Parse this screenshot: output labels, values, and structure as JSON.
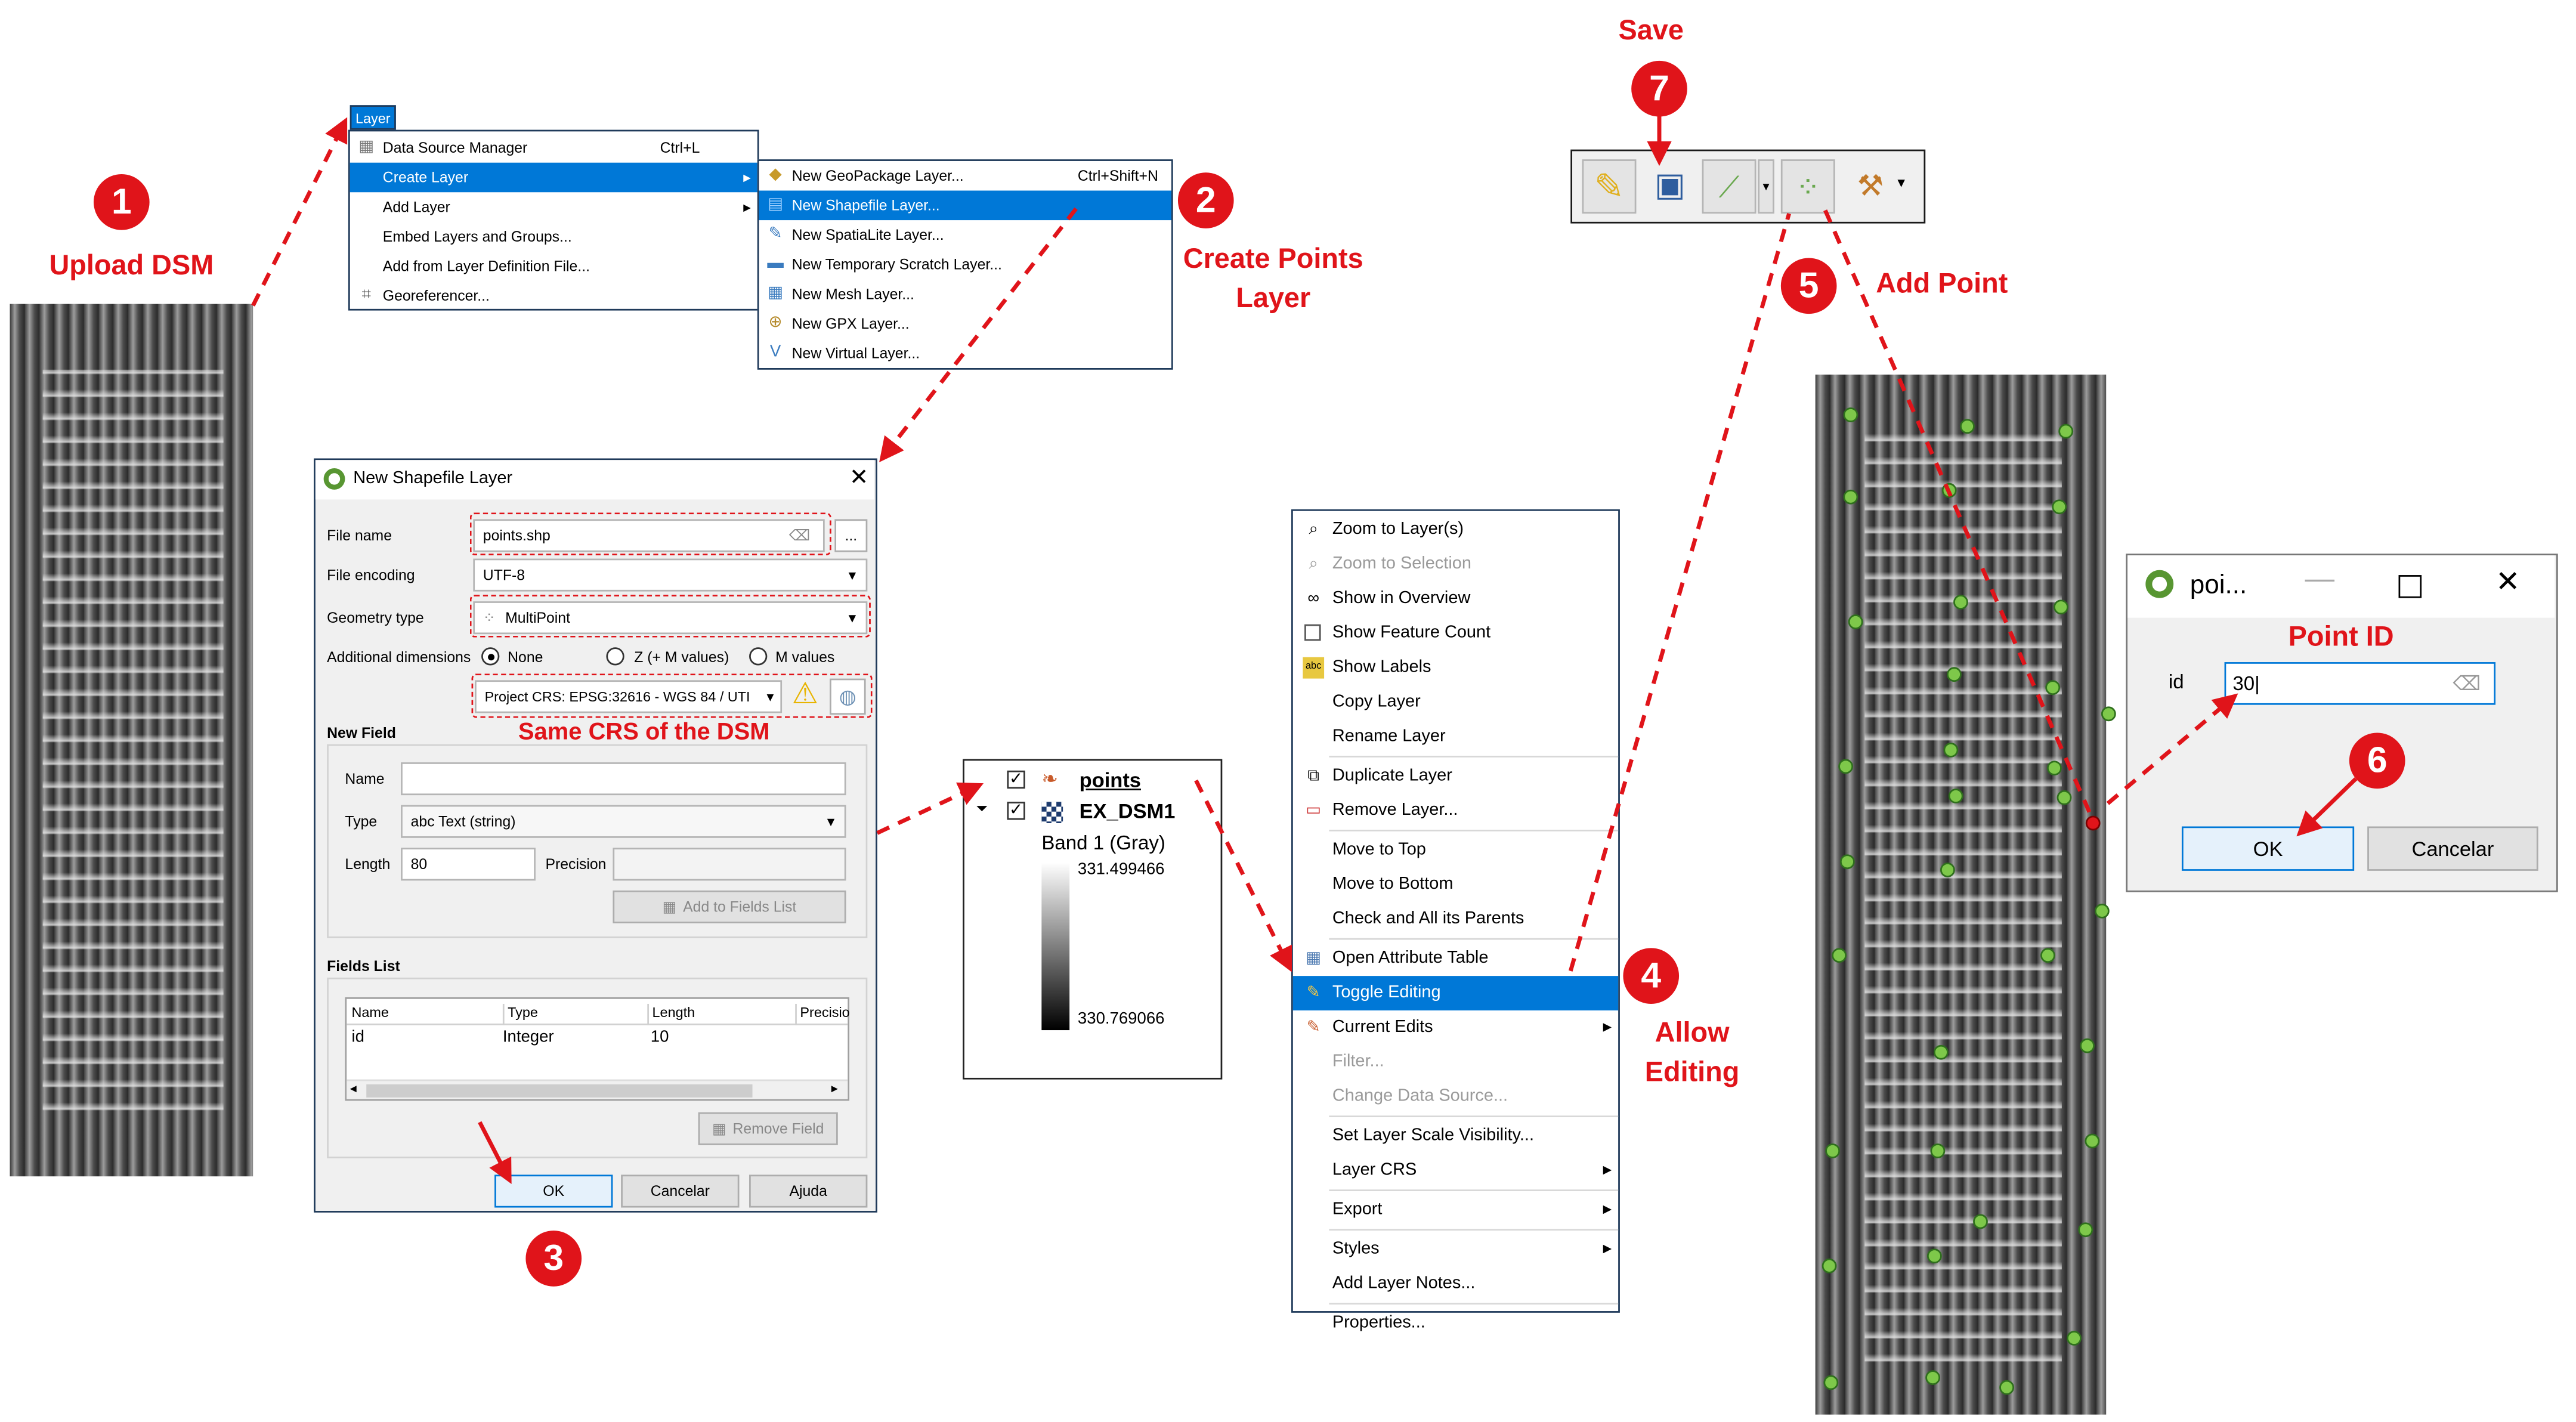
{
  "annotations": {
    "step1": {
      "num": "1",
      "label": "Upload DSM"
    },
    "step2": {
      "num": "2",
      "label_line1": "Create Points",
      "label_line2": "Layer"
    },
    "step3": {
      "num": "3"
    },
    "step4": {
      "num": "4",
      "label_line1": "Allow",
      "label_line2": "Editing"
    },
    "step5": {
      "num": "5",
      "label": "Add Point"
    },
    "step6": {
      "num": "6"
    },
    "step7": {
      "num": "7",
      "label": "Save"
    },
    "crs_note": "Same CRS of the DSM",
    "point_id_note": "Point ID"
  },
  "layer_menu": {
    "title": "Layer",
    "items": [
      {
        "label": "Data Source Manager",
        "shortcut": "Ctrl+L",
        "icon": "data-source-icon"
      },
      {
        "label": "Create Layer",
        "submenu": true,
        "selected": true
      },
      {
        "label": "Add Layer",
        "submenu": true
      },
      {
        "label": "Embed Layers and Groups..."
      },
      {
        "label": "Add from Layer Definition File..."
      },
      {
        "label": "Georeferencer...",
        "icon": "georeferencer-icon"
      }
    ]
  },
  "create_layer_submenu": {
    "items": [
      {
        "label": "New GeoPackage Layer...",
        "shortcut": "Ctrl+Shift+N"
      },
      {
        "label": "New Shapefile Layer...",
        "selected": true
      },
      {
        "label": "New SpatiaLite Layer..."
      },
      {
        "label": "New Temporary Scratch Layer..."
      },
      {
        "label": "New Mesh Layer..."
      },
      {
        "label": "New GPX Layer..."
      },
      {
        "label": "New Virtual Layer..."
      }
    ]
  },
  "shapefile_dialog": {
    "title": "New Shapefile Layer",
    "file_name_label": "File name",
    "file_name_value": "points.shp",
    "browse_label": "...",
    "file_encoding_label": "File encoding",
    "file_encoding_value": "UTF-8",
    "geometry_type_label": "Geometry type",
    "geometry_type_value": "MultiPoint",
    "additional_dimensions_label": "Additional dimensions",
    "dimension_options": [
      "None",
      "Z (+ M values)",
      "M values"
    ],
    "crs_value": "Project CRS: EPSG:32616 - WGS 84 / UTI",
    "new_field_label": "New Field",
    "name_label": "Name",
    "name_value": "",
    "type_label": "Type",
    "type_value": "abc Text (string)",
    "length_label": "Length",
    "length_value": "80",
    "precision_label": "Precision",
    "precision_value": "",
    "add_to_fields_label": "Add to Fields List",
    "fields_list_label": "Fields List",
    "fields_columns": [
      "Name",
      "Type",
      "Length",
      "Precisio"
    ],
    "fields_rows": [
      {
        "name": "id",
        "type": "Integer",
        "length": "10"
      }
    ],
    "remove_field_label": "Remove Field",
    "ok_label": "OK",
    "cancel_label": "Cancelar",
    "help_label": "Ajuda"
  },
  "layers_panel": {
    "layers": [
      {
        "name": "points",
        "checked": true
      },
      {
        "name": "EX_DSM1",
        "checked": true
      }
    ],
    "band_label": "Band 1 (Gray)",
    "max_value": "331.499466",
    "min_value": "330.769066"
  },
  "context_menu": {
    "items": [
      {
        "label": "Zoom to Layer(s)"
      },
      {
        "label": "Zoom to Selection",
        "disabled": true
      },
      {
        "label": "Show in Overview"
      },
      {
        "label": "Show Feature Count"
      },
      {
        "label": "Show Labels"
      },
      {
        "label": "Copy Layer"
      },
      {
        "label": "Rename Layer"
      },
      {
        "label": "Duplicate Layer"
      },
      {
        "label": "Remove Layer..."
      },
      {
        "label": "Move to Top"
      },
      {
        "label": "Move to Bottom"
      },
      {
        "label": "Check and All its Parents"
      },
      {
        "label": "Open Attribute Table"
      },
      {
        "label": "Toggle Editing",
        "selected": true
      },
      {
        "label": "Current Edits",
        "submenu": true
      },
      {
        "label": "Filter...",
        "disabled": true
      },
      {
        "label": "Change Data Source...",
        "disabled": true
      },
      {
        "label": "Set Layer Scale Visibility..."
      },
      {
        "label": "Layer CRS",
        "submenu": true
      },
      {
        "label": "Export",
        "submenu": true
      },
      {
        "label": "Styles",
        "submenu": true
      },
      {
        "label": "Add Layer Notes..."
      },
      {
        "label": "Properties..."
      }
    ]
  },
  "point_dialog": {
    "title": "poi...",
    "id_label": "id",
    "id_value": "30",
    "ok_label": "OK",
    "cancel_label": "Cancelar"
  },
  "colors": {
    "annotation": "#e0141a",
    "selection": "#0078d7",
    "frame": "#1f3a5a",
    "point_fill": "#7ec84a"
  }
}
